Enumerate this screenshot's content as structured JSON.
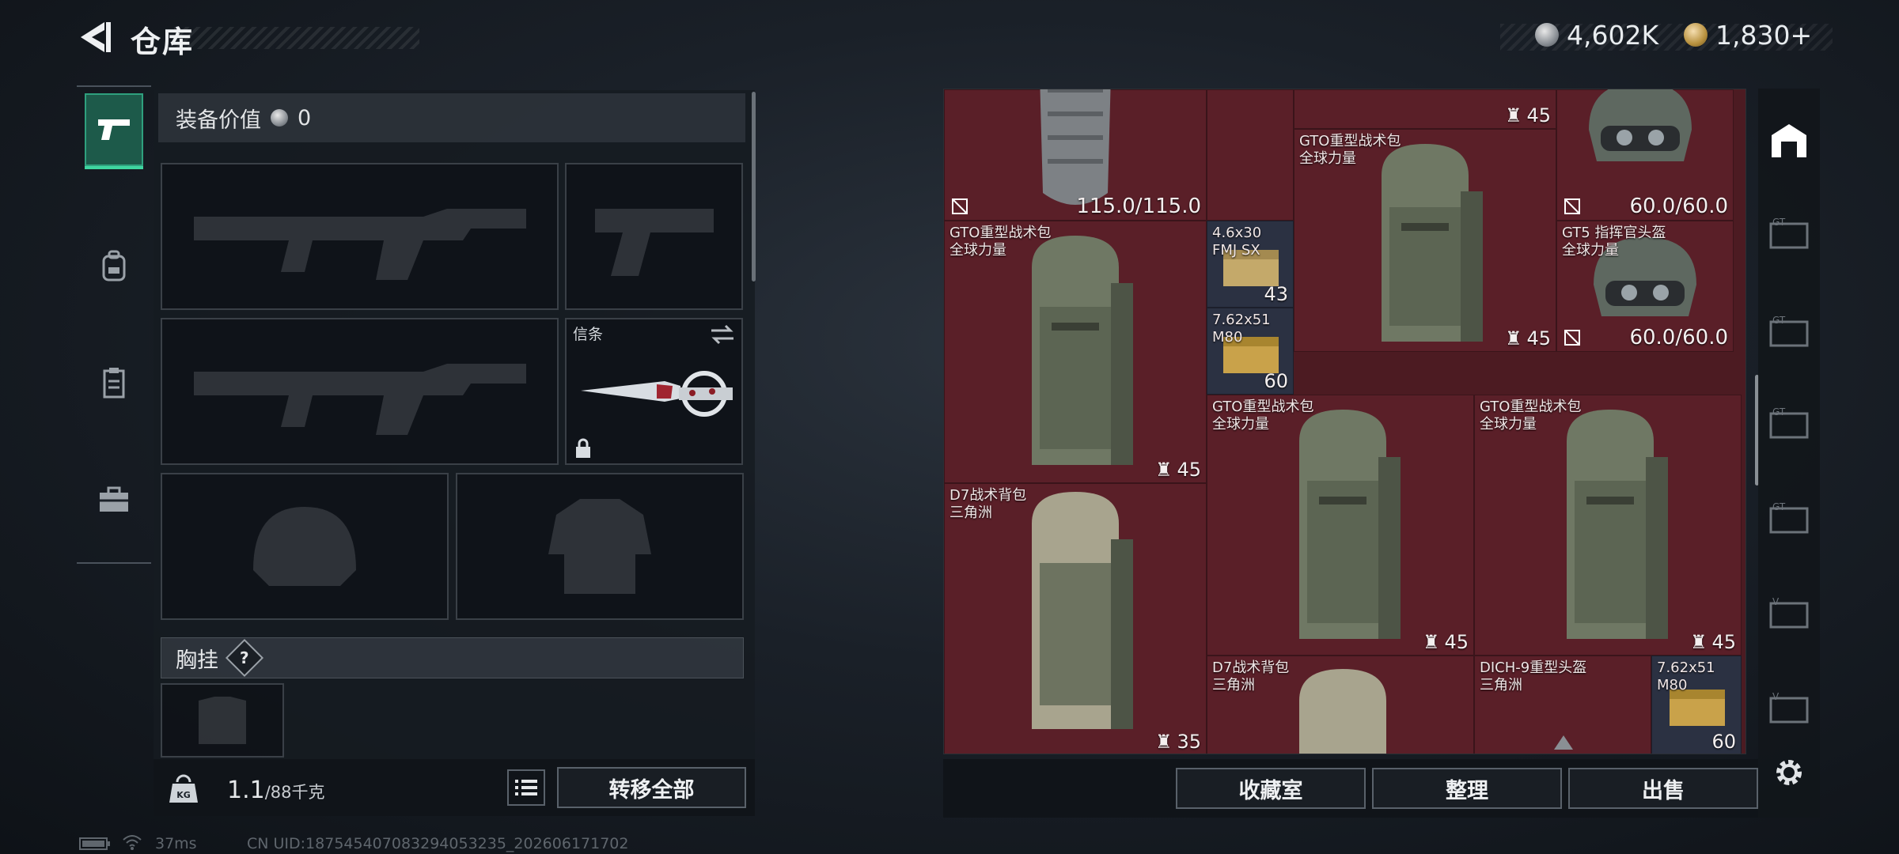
{
  "header": {
    "title": "仓库",
    "currency_silver": "4,602K",
    "currency_gold": "1,830+"
  },
  "left": {
    "equip_value_label": "装备价值",
    "equip_value": "0",
    "knife_slot_label": "信条",
    "chest_rig_label": "胸挂",
    "help_glyph": "?",
    "weight_value": "1.1",
    "weight_max": "/88千克",
    "transfer_all": "转移全部"
  },
  "grid": {
    "items": [
      {
        "id": "top-bag",
        "name": "",
        "sub": "",
        "count": "45"
      },
      {
        "id": "bag-a",
        "name": "GTO重型战术包",
        "sub": "全球力量",
        "count": "45"
      },
      {
        "id": "helmet-top",
        "name": "",
        "sub": "",
        "dur": "60.0/60.0"
      },
      {
        "id": "vest",
        "name": "",
        "sub": "",
        "dur": "115.0/115.0"
      },
      {
        "id": "bag-b",
        "name": "GTO重型战术包",
        "sub": "全球力量",
        "count": "45"
      },
      {
        "id": "ammo-a",
        "name": "4.6x30",
        "sub": "FMJ SX",
        "count": "43"
      },
      {
        "id": "ammo-b",
        "name": "7.62x51",
        "sub": "M80",
        "count": "60"
      },
      {
        "id": "helmet-gt5",
        "name": "GT5 指挥官头盔",
        "sub": "全球力量",
        "dur": "60.0/60.0"
      },
      {
        "id": "bag-c",
        "name": "GTO重型战术包",
        "sub": "全球力量",
        "count": "45"
      },
      {
        "id": "bag-d",
        "name": "GTO重型战术包",
        "sub": "全球力量",
        "count": "45"
      },
      {
        "id": "d7-a",
        "name": "D7战术背包",
        "sub": "三角洲",
        "count": "35"
      },
      {
        "id": "d7-b",
        "name": "D7战术背包",
        "sub": "三角洲",
        "count": ""
      },
      {
        "id": "dich",
        "name": "DICH-9重型头盔",
        "sub": "三角洲",
        "count": ""
      },
      {
        "id": "ammo-c",
        "name": "7.62x51",
        "sub": "M80",
        "count": "60"
      }
    ],
    "buttons": {
      "collection": "收藏室",
      "sort": "整理",
      "sell": "出售"
    }
  },
  "status": {
    "ping": "37ms",
    "uid": "CN UID:18754540708329405323​5_202606171702"
  },
  "colors": {
    "accent": "#2fa07e",
    "grid_bg": "#5a1f28",
    "ammo_bg": "#2b3142"
  }
}
